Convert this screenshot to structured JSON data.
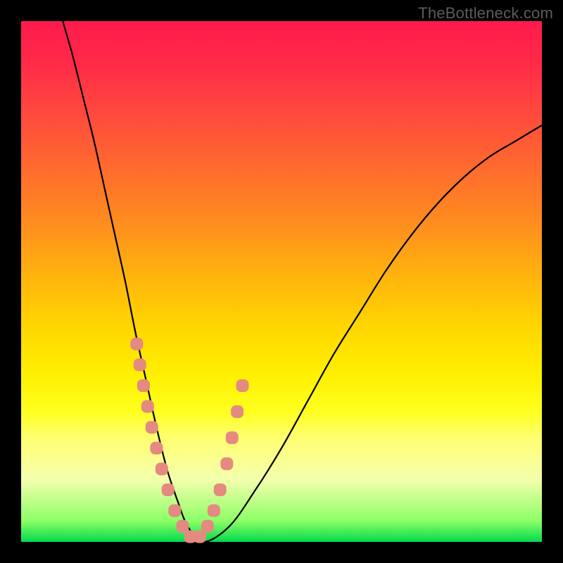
{
  "watermark": "TheBottleneck.com",
  "chart_data": {
    "type": "line",
    "title": "",
    "xlabel": "",
    "ylabel": "",
    "xlim": [
      0,
      100
    ],
    "ylim": [
      0,
      100
    ],
    "series": [
      {
        "name": "bottleneck-curve",
        "x": [
          8,
          10,
          12,
          14,
          16,
          18,
          20,
          22,
          24,
          26,
          28,
          30,
          32,
          35,
          40,
          45,
          50,
          55,
          60,
          65,
          70,
          75,
          80,
          85,
          90,
          95,
          100
        ],
        "y": [
          100,
          93,
          85,
          77,
          68,
          59,
          50,
          40,
          31,
          22,
          14,
          8,
          3,
          0,
          3,
          10,
          18,
          27,
          36,
          44,
          52,
          59,
          65,
          70,
          74,
          77,
          80
        ]
      }
    ],
    "markers": {
      "name": "data-points",
      "color": "#e48a80",
      "x": [
        22.2,
        22.8,
        23.5,
        24.3,
        25.1,
        26.0,
        27.0,
        28.2,
        29.5,
        31.0,
        32.5,
        34.3,
        35.8,
        37.0,
        38.2,
        39.5,
        40.5,
        41.5,
        42.5
      ],
      "y": [
        38,
        34,
        30,
        26,
        22,
        18,
        14,
        10,
        6,
        3,
        1,
        1,
        3,
        6,
        10,
        15,
        20,
        25,
        30
      ]
    }
  }
}
